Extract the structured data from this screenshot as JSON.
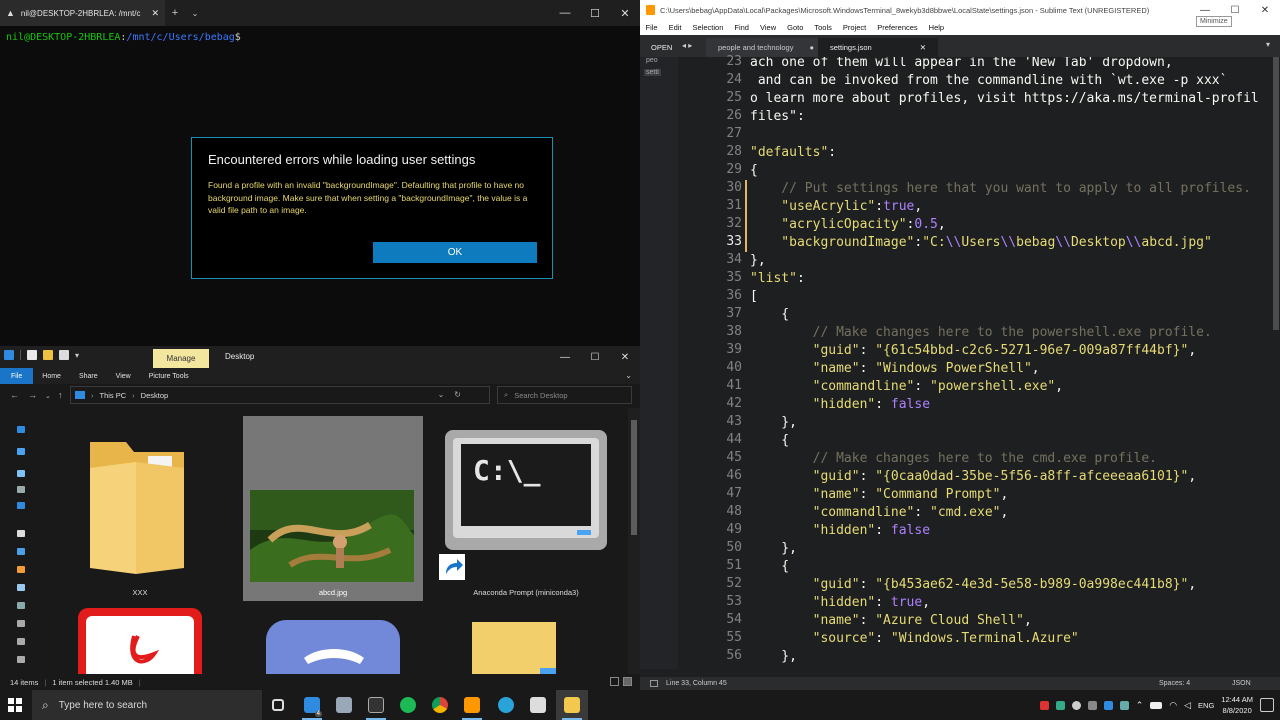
{
  "terminal": {
    "tab_title": "nil@DESKTOP-2HBRLEA: /mnt/c",
    "prompt_user": "nil@DESKTOP-2HBRLEA",
    "prompt_sep": ":",
    "prompt_path": "/mnt/c/Users/bebag",
    "prompt_symbol": "$",
    "dialog": {
      "title": "Encountered errors while loading user settings",
      "message": "Found a profile with an invalid \"backgroundImage\". Defaulting that profile to have no background image. Make sure that when setting a \"backgroundImage\", the value is a valid file path to an image.",
      "ok_label": "OK"
    }
  },
  "explorer": {
    "manage_label": "Manage",
    "title": "Desktop",
    "ribbon_tabs": [
      "File",
      "Home",
      "Share",
      "View",
      "Picture Tools"
    ],
    "breadcrumb": [
      "This PC",
      "Desktop"
    ],
    "search_placeholder": "Search Desktop",
    "items": [
      {
        "label": "XXX",
        "icon": "folder-icon"
      },
      {
        "label": "abcd.jpg",
        "icon": "image-thumbnail"
      },
      {
        "label": "Anaconda Prompt (miniconda3)",
        "icon": "terminal-shortcut-icon"
      }
    ],
    "status": {
      "count": "14 items",
      "selected": "1 item selected  1.40 MB"
    }
  },
  "sublime": {
    "title": "C:\\Users\\bebag\\AppData\\Local\\Packages\\Microsoft.WindowsTerminal_8wekyb3d8bbwe\\LocalState\\settings.json - Sublime Text (UNREGISTERED)",
    "tooltip": "Minimize",
    "menu": [
      "File",
      "Edit",
      "Selection",
      "Find",
      "View",
      "Goto",
      "Tools",
      "Project",
      "Preferences",
      "Help"
    ],
    "open_label": "OPEN",
    "tabs": [
      {
        "label": "people and technology"
      },
      {
        "label": "settings.json"
      }
    ],
    "sidebar_files": [
      "peo",
      "setti"
    ],
    "current_line": 33,
    "status": {
      "position": "Line 33, Column 45",
      "spaces": "Spaces: 4",
      "syntax": "JSON"
    }
  },
  "taskbar": {
    "search_placeholder": "Type here to search",
    "tray": {
      "lang": "ENG",
      "time": "12:44 AM",
      "date": "8/8/2020",
      "badge": "4"
    }
  },
  "colors": {
    "accent": "#0e7bbf",
    "dialog_border": "#1b8fb3",
    "warning_text": "#e9d86e",
    "manage_tab": "#f3e7a0"
  }
}
